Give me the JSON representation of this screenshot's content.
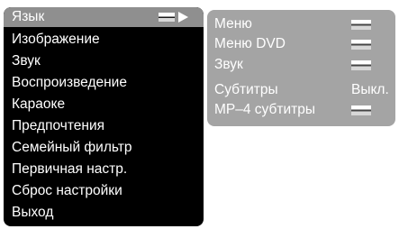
{
  "main_menu": {
    "items": [
      {
        "label": "Язык"
      },
      {
        "label": "Изображение"
      },
      {
        "label": "Звук"
      },
      {
        "label": "Воспроизведение"
      },
      {
        "label": "Караоке"
      },
      {
        "label": "Предпочтения"
      },
      {
        "label": "Семейный фильтр"
      },
      {
        "label": "Первичная настр."
      },
      {
        "label": "Сброс настройки"
      },
      {
        "label": "Выход"
      }
    ],
    "selected_index": 0,
    "selector_icon": "selection-bar-icon",
    "arrow_icon": "triangle-right-icon"
  },
  "sub_menu": {
    "items": [
      {
        "label": "Меню",
        "value_icon": "value-bar-icon"
      },
      {
        "label": "Меню DVD",
        "value_icon": "value-bar-icon"
      },
      {
        "label": "Звук",
        "value_icon": "value-bar-icon"
      },
      {
        "label": "Субтитры",
        "value": "Выкл."
      },
      {
        "label": "MP–4 субтитры",
        "value_icon": "value-bar-icon"
      }
    ]
  },
  "colors": {
    "main_bg": "#000000",
    "selected_bg": "#8f8f8f",
    "sub_bg": "#a4a4a4",
    "text": "#ffffff"
  }
}
